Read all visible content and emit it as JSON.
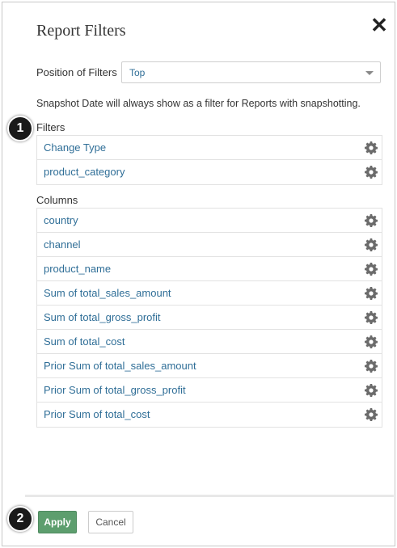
{
  "dialog": {
    "title": "Report Filters",
    "close_label": "✕"
  },
  "position": {
    "label": "Position of Filters",
    "selected": "Top"
  },
  "note": "Snapshot Date will always show as a filter for Reports with snapshotting.",
  "filters": {
    "label": "Filters",
    "items": [
      "Change Type",
      "product_category"
    ]
  },
  "columns": {
    "label": "Columns",
    "items": [
      "country",
      "channel",
      "product_name",
      "Sum of total_sales_amount",
      "Sum of total_gross_profit",
      "Sum of total_cost",
      "Prior Sum of total_sales_amount",
      "Prior Sum of total_gross_profit",
      "Prior Sum of total_cost"
    ]
  },
  "footer": {
    "apply_label": "Apply",
    "cancel_label": "Cancel"
  },
  "badges": [
    "1",
    "2"
  ],
  "colors": {
    "link": "#2f6e97",
    "apply": "#5d9e6e",
    "badge": "#1a1a1a"
  }
}
